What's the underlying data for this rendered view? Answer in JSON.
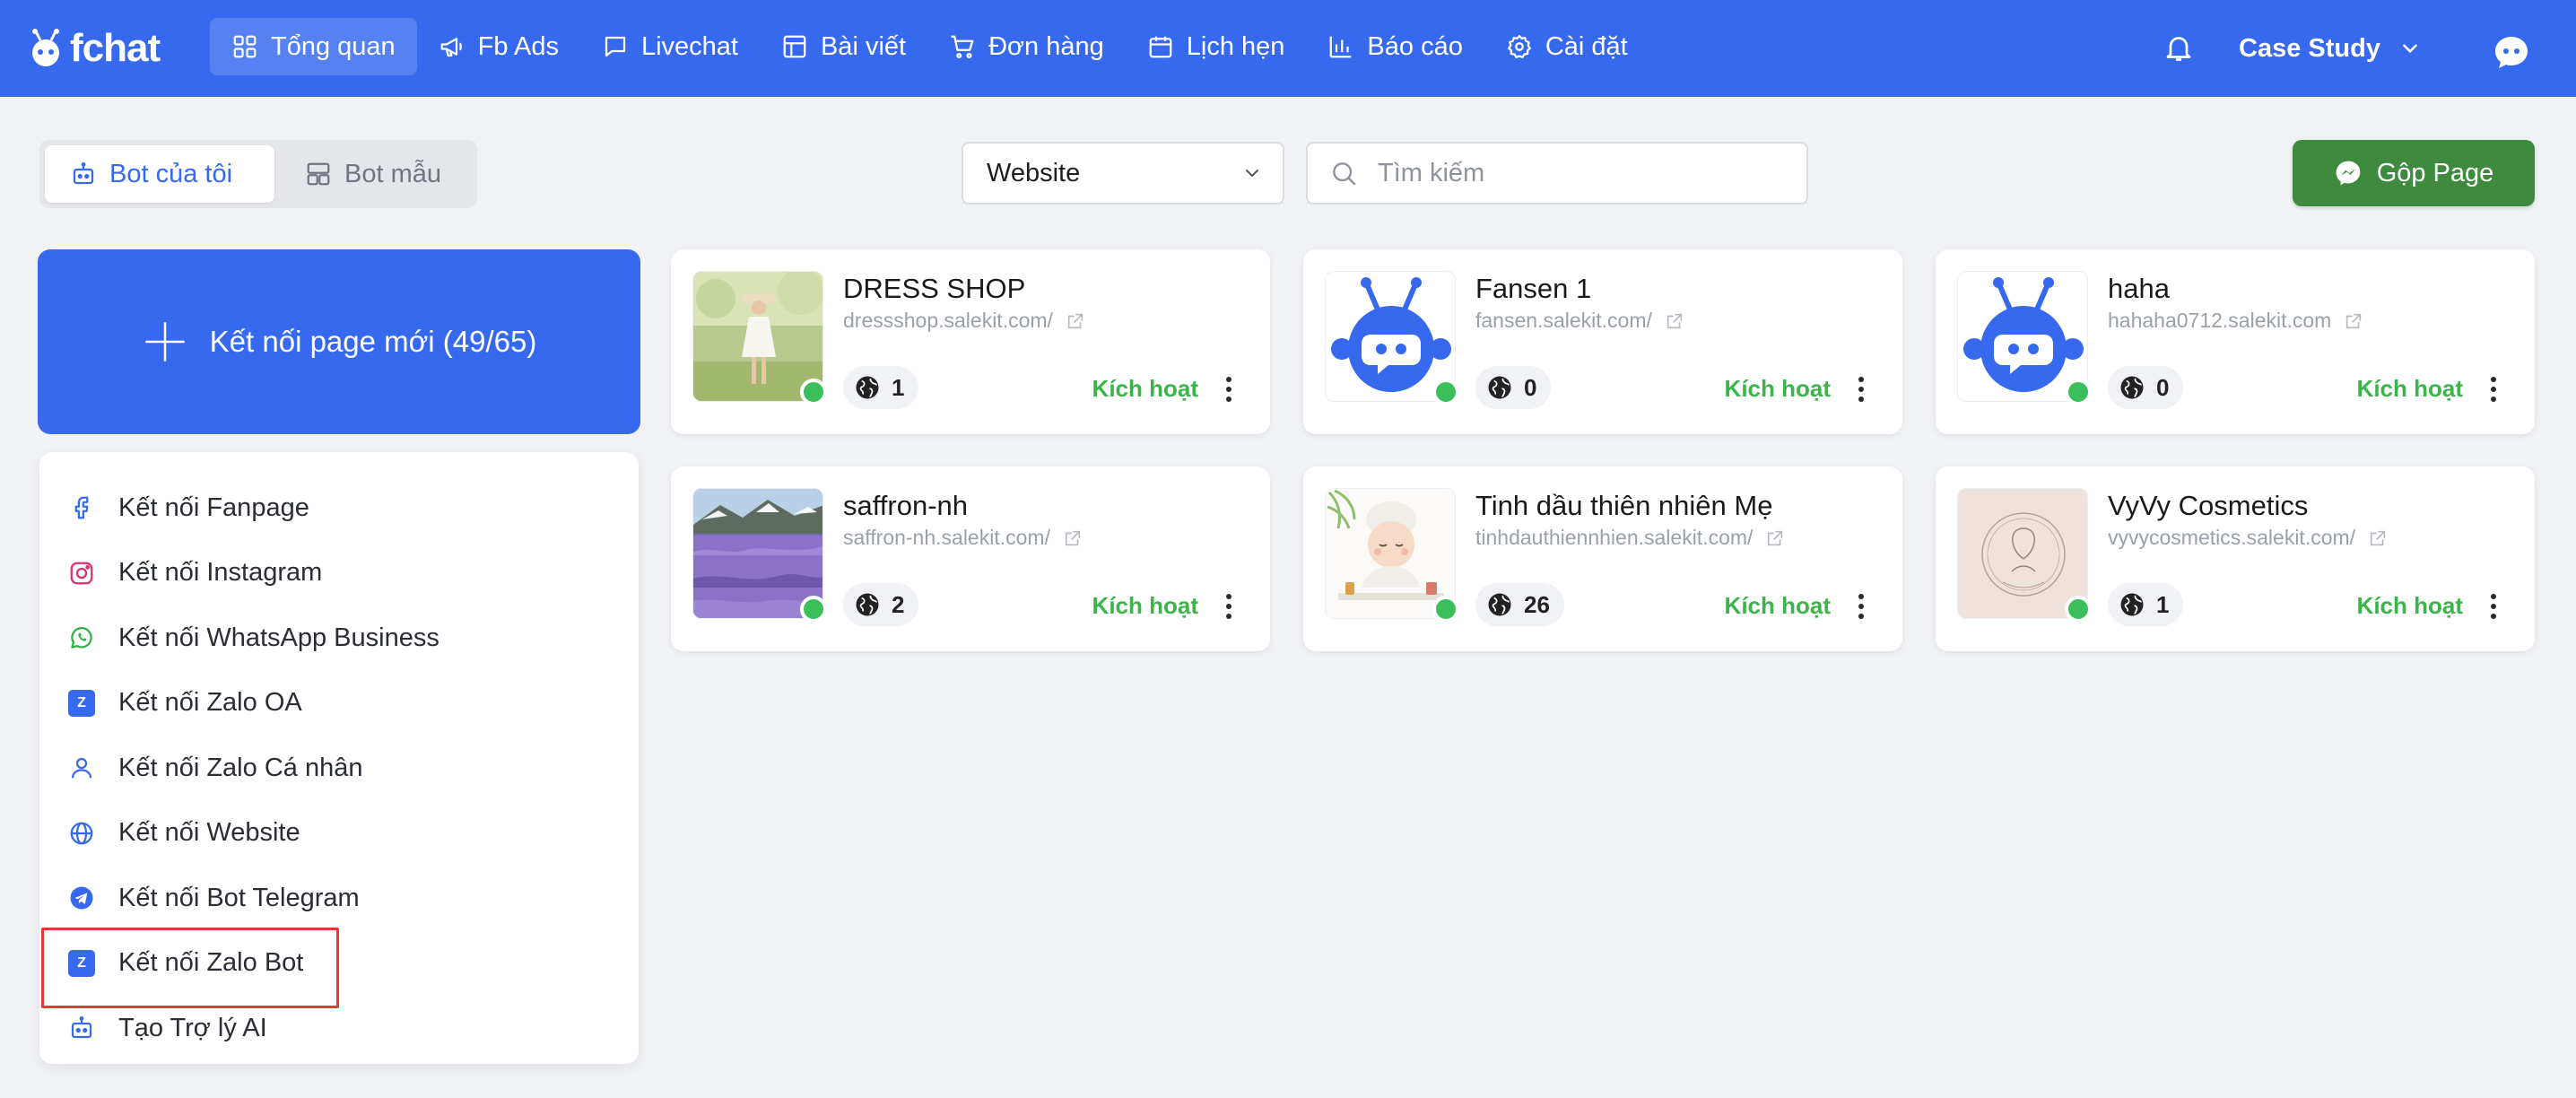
{
  "app": {
    "logo_text": "fchat"
  },
  "nav": {
    "items": [
      {
        "label": "Tổng quan",
        "icon": "grid-icon",
        "active": true
      },
      {
        "label": "Fb Ads",
        "icon": "megaphone-icon",
        "active": false
      },
      {
        "label": "Livechat",
        "icon": "chat-bubble-icon",
        "active": false
      },
      {
        "label": "Bài viết",
        "icon": "layout-icon",
        "active": false
      },
      {
        "label": "Đơn hàng",
        "icon": "cart-icon",
        "active": false
      },
      {
        "label": "Lịch hẹn",
        "icon": "calendar-icon",
        "active": false
      },
      {
        "label": "Báo cáo",
        "icon": "bar-chart-icon",
        "active": false
      },
      {
        "label": "Cài đặt",
        "icon": "gear-icon",
        "active": false
      }
    ],
    "account_name": "Case Study"
  },
  "toolbar": {
    "tabs": [
      {
        "label": "Bot của tôi",
        "icon": "bot-icon",
        "active": true
      },
      {
        "label": "Bot mẫu",
        "icon": "template-icon",
        "active": false
      }
    ],
    "filter_value": "Website",
    "search_placeholder": "Tìm kiếm",
    "merge_label": "Gộp Page"
  },
  "connect": {
    "hero_label": "Kết nối page mới (49/65)",
    "items": [
      {
        "label": "Kết nối Fanpage",
        "icon": "facebook-icon"
      },
      {
        "label": "Kết nối Instagram",
        "icon": "instagram-icon"
      },
      {
        "label": "Kết nối WhatsApp Business",
        "icon": "whatsapp-icon"
      },
      {
        "label": "Kết nối Zalo OA",
        "icon": "zalo-icon"
      },
      {
        "label": "Kết nối Zalo Cá nhân",
        "icon": "user-icon"
      },
      {
        "label": "Kết nối Website",
        "icon": "globe-icon"
      },
      {
        "label": "Kết nối Bot Telegram",
        "icon": "telegram-icon"
      },
      {
        "label": "Kết nối Zalo Bot",
        "icon": "zalo-icon",
        "highlighted": true
      },
      {
        "label": "Tạo Trợ lý AI",
        "icon": "bot-icon"
      }
    ]
  },
  "bots": [
    {
      "name": "DRESS SHOP",
      "url": "dressshop.salekit.com/",
      "count": "1",
      "status": "Kích hoạt",
      "thumb": "photo-dress"
    },
    {
      "name": "Fansen 1",
      "url": "fansen.salekit.com/",
      "count": "0",
      "status": "Kích hoạt",
      "thumb": "bot-avatar"
    },
    {
      "name": "haha",
      "url": "hahaha0712.salekit.com",
      "count": "0",
      "status": "Kích hoạt",
      "thumb": "bot-avatar"
    },
    {
      "name": "saffron-nh",
      "url": "saffron-nh.salekit.com/",
      "count": "2",
      "status": "Kích hoạt",
      "thumb": "photo-field"
    },
    {
      "name": "Tinh dầu thiên nhiên Mẹ",
      "url": "tinhdauthiennhien.salekit.com/",
      "count": "26",
      "status": "Kích hoạt",
      "thumb": "photo-spa"
    },
    {
      "name": "VyVy Cosmetics",
      "url": "vyvycosmetics.salekit.com/",
      "count": "1",
      "status": "Kích hoạt",
      "thumb": "photo-logo"
    }
  ],
  "colors": {
    "primary": "#3669ee",
    "success": "#3bb54a",
    "merge": "#3e8a3f",
    "online": "#3bbf5a",
    "highlight": "#e53935"
  }
}
